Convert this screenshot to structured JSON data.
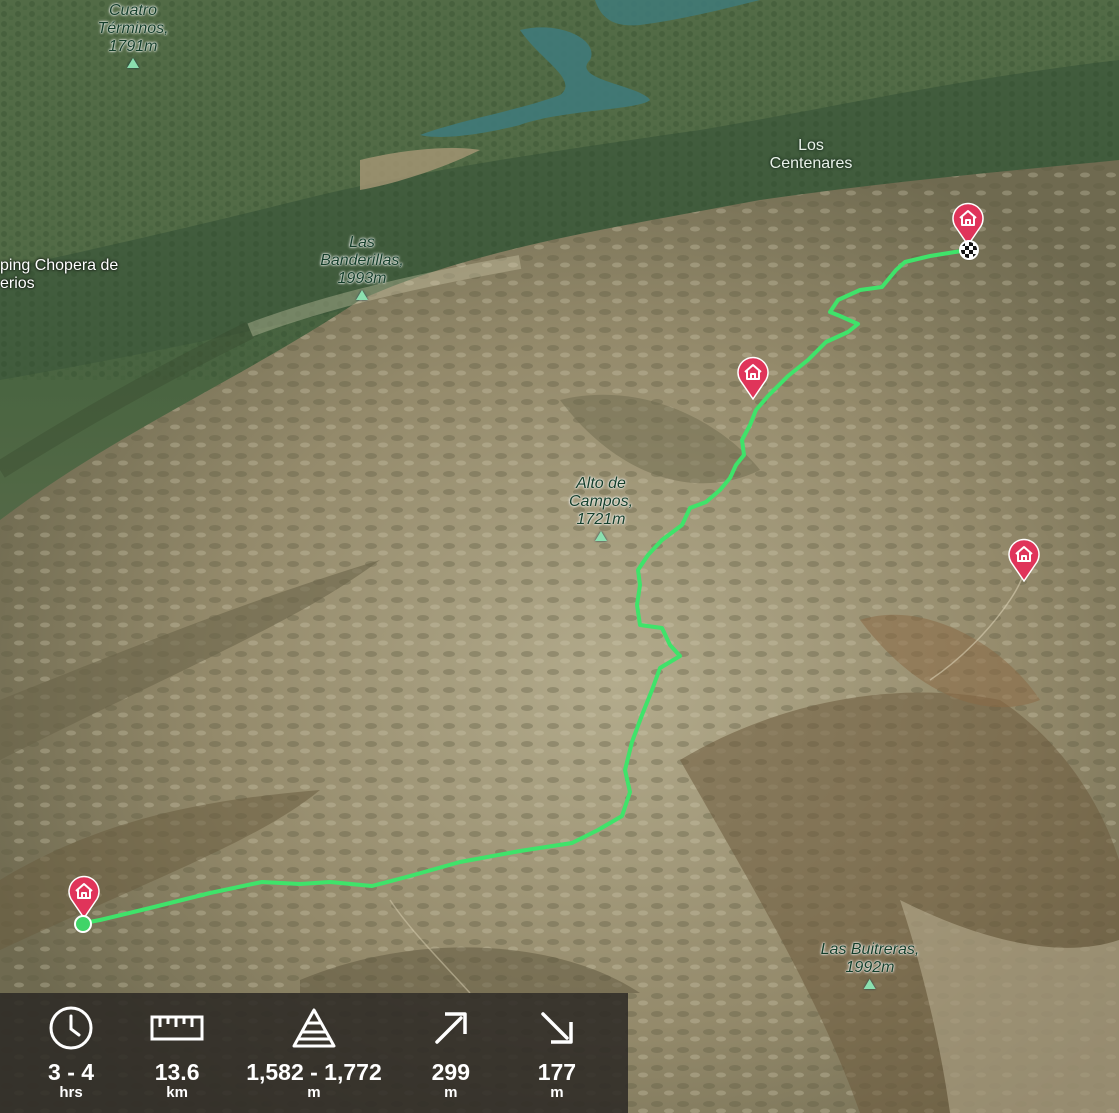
{
  "map": {
    "labels": {
      "cuatro_terminos": {
        "name": "Cuatro Términos,",
        "elevation": "1791m"
      },
      "las_banderillas": {
        "name": "Las Banderillas,",
        "elevation": "1993m"
      },
      "alto_de_campos": {
        "name_line1": "Alto de",
        "name_line2": "Campos,",
        "elevation": "1721m"
      },
      "las_buitreras": {
        "name": "Las Buitreras,",
        "elevation": "1992m"
      },
      "los_centenares": {
        "line1": "Los",
        "line2": "Centenares"
      },
      "camping_chopera": {
        "line1": "ping Chopera de",
        "line2": "erios"
      }
    },
    "route_color": "#3fe36a",
    "marker_color": "#e0345a",
    "marker_icon": "home-icon",
    "start_color": "#3fd468"
  },
  "stats": {
    "duration": {
      "icon": "clock-icon",
      "value": "3 - 4",
      "unit": "hrs"
    },
    "distance": {
      "icon": "ruler-icon",
      "value": "13.6",
      "unit": "km"
    },
    "elevation_range": {
      "icon": "elevation-icon",
      "value": "1,582 - 1,772",
      "unit": "m"
    },
    "ascent": {
      "icon": "arrow-up-right-icon",
      "value": "299",
      "unit": "m"
    },
    "descent": {
      "icon": "arrow-down-right-icon",
      "value": "177",
      "unit": "m"
    }
  }
}
